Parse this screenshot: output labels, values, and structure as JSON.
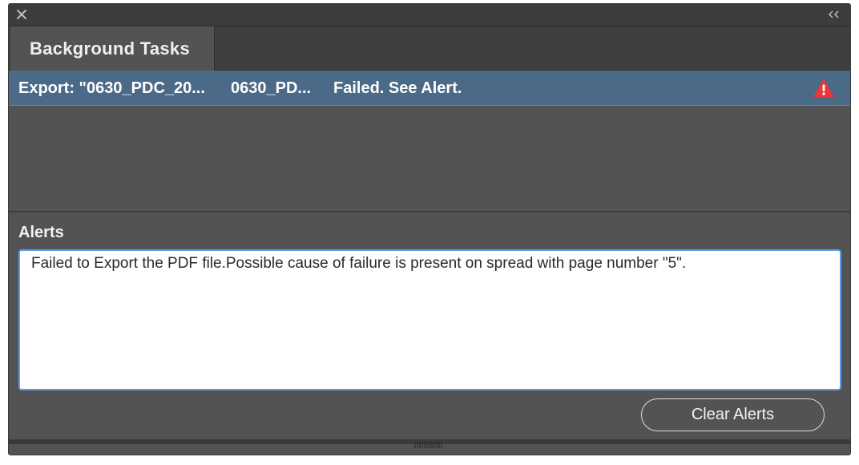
{
  "panel": {
    "tab_label": "Background Tasks"
  },
  "task": {
    "name": "Export: \"0630_PDC_20...",
    "file": "0630_PD...",
    "status": "Failed. See Alert.",
    "icon": "warning-triangle-icon"
  },
  "alerts": {
    "label": "Alerts",
    "message": "Failed to Export the PDF file.Possible cause of failure is present on spread with page number \"5\"."
  },
  "buttons": {
    "clear_alerts": "Clear Alerts"
  },
  "colors": {
    "panel_bg": "#535353",
    "selected_row": "#4b6a88",
    "warning": "#e53935",
    "focus_border": "#5aa0e8"
  }
}
